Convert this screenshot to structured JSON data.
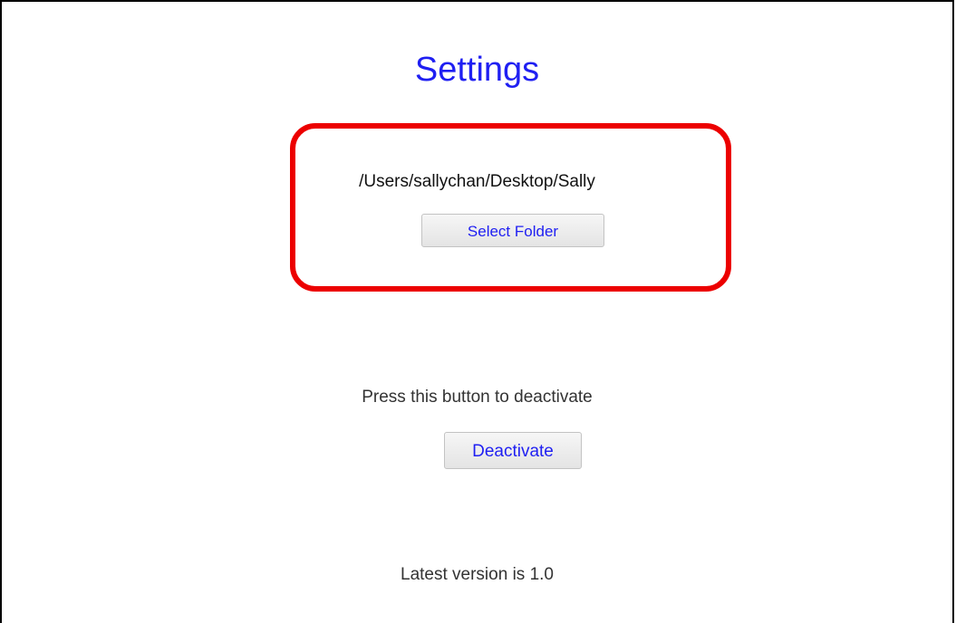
{
  "settings": {
    "title": "Settings",
    "folder_path": "/Users/sallychan/Desktop/Sally",
    "select_folder_label": "Select Folder",
    "deactivate_prompt": "Press this button to deactivate",
    "deactivate_label": "Deactivate",
    "version_text": "Latest version is 1.0"
  },
  "colors": {
    "title_color": "#1f1ff2",
    "button_text_color": "#1f1ff2",
    "highlight_border_color": "#ec0000"
  }
}
